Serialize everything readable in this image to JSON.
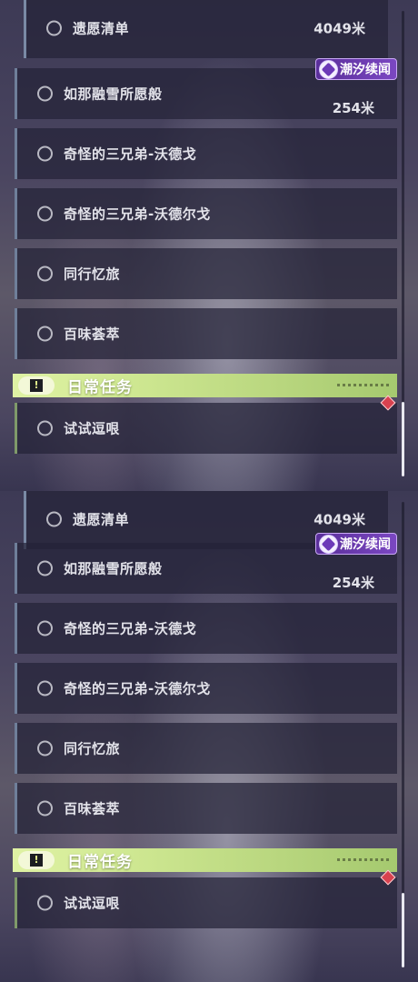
{
  "quests": [
    {
      "name": "遗愿清单",
      "distance": "4049米"
    },
    {
      "name": "如那融雪所愿般",
      "distance": "254米",
      "tag": "潮汐续闻"
    },
    {
      "name": "奇怪的三兄弟-沃德戈"
    },
    {
      "name": "奇怪的三兄弟-沃德尔戈"
    },
    {
      "name": "同行忆旅"
    },
    {
      "name": "百味荟萃"
    }
  ],
  "daily": {
    "header": "日常任务",
    "icon_glyph": "!",
    "items": [
      {
        "name": "试试逗哏"
      }
    ]
  },
  "colors": {
    "tag_purple": "#6c3ab8",
    "daily_green": "#cfe892",
    "marker_red": "#d8424f"
  },
  "icons": [
    "radio-circle-icon",
    "tide-story-icon",
    "daily-quest-icon",
    "red-diamond-marker-icon"
  ]
}
